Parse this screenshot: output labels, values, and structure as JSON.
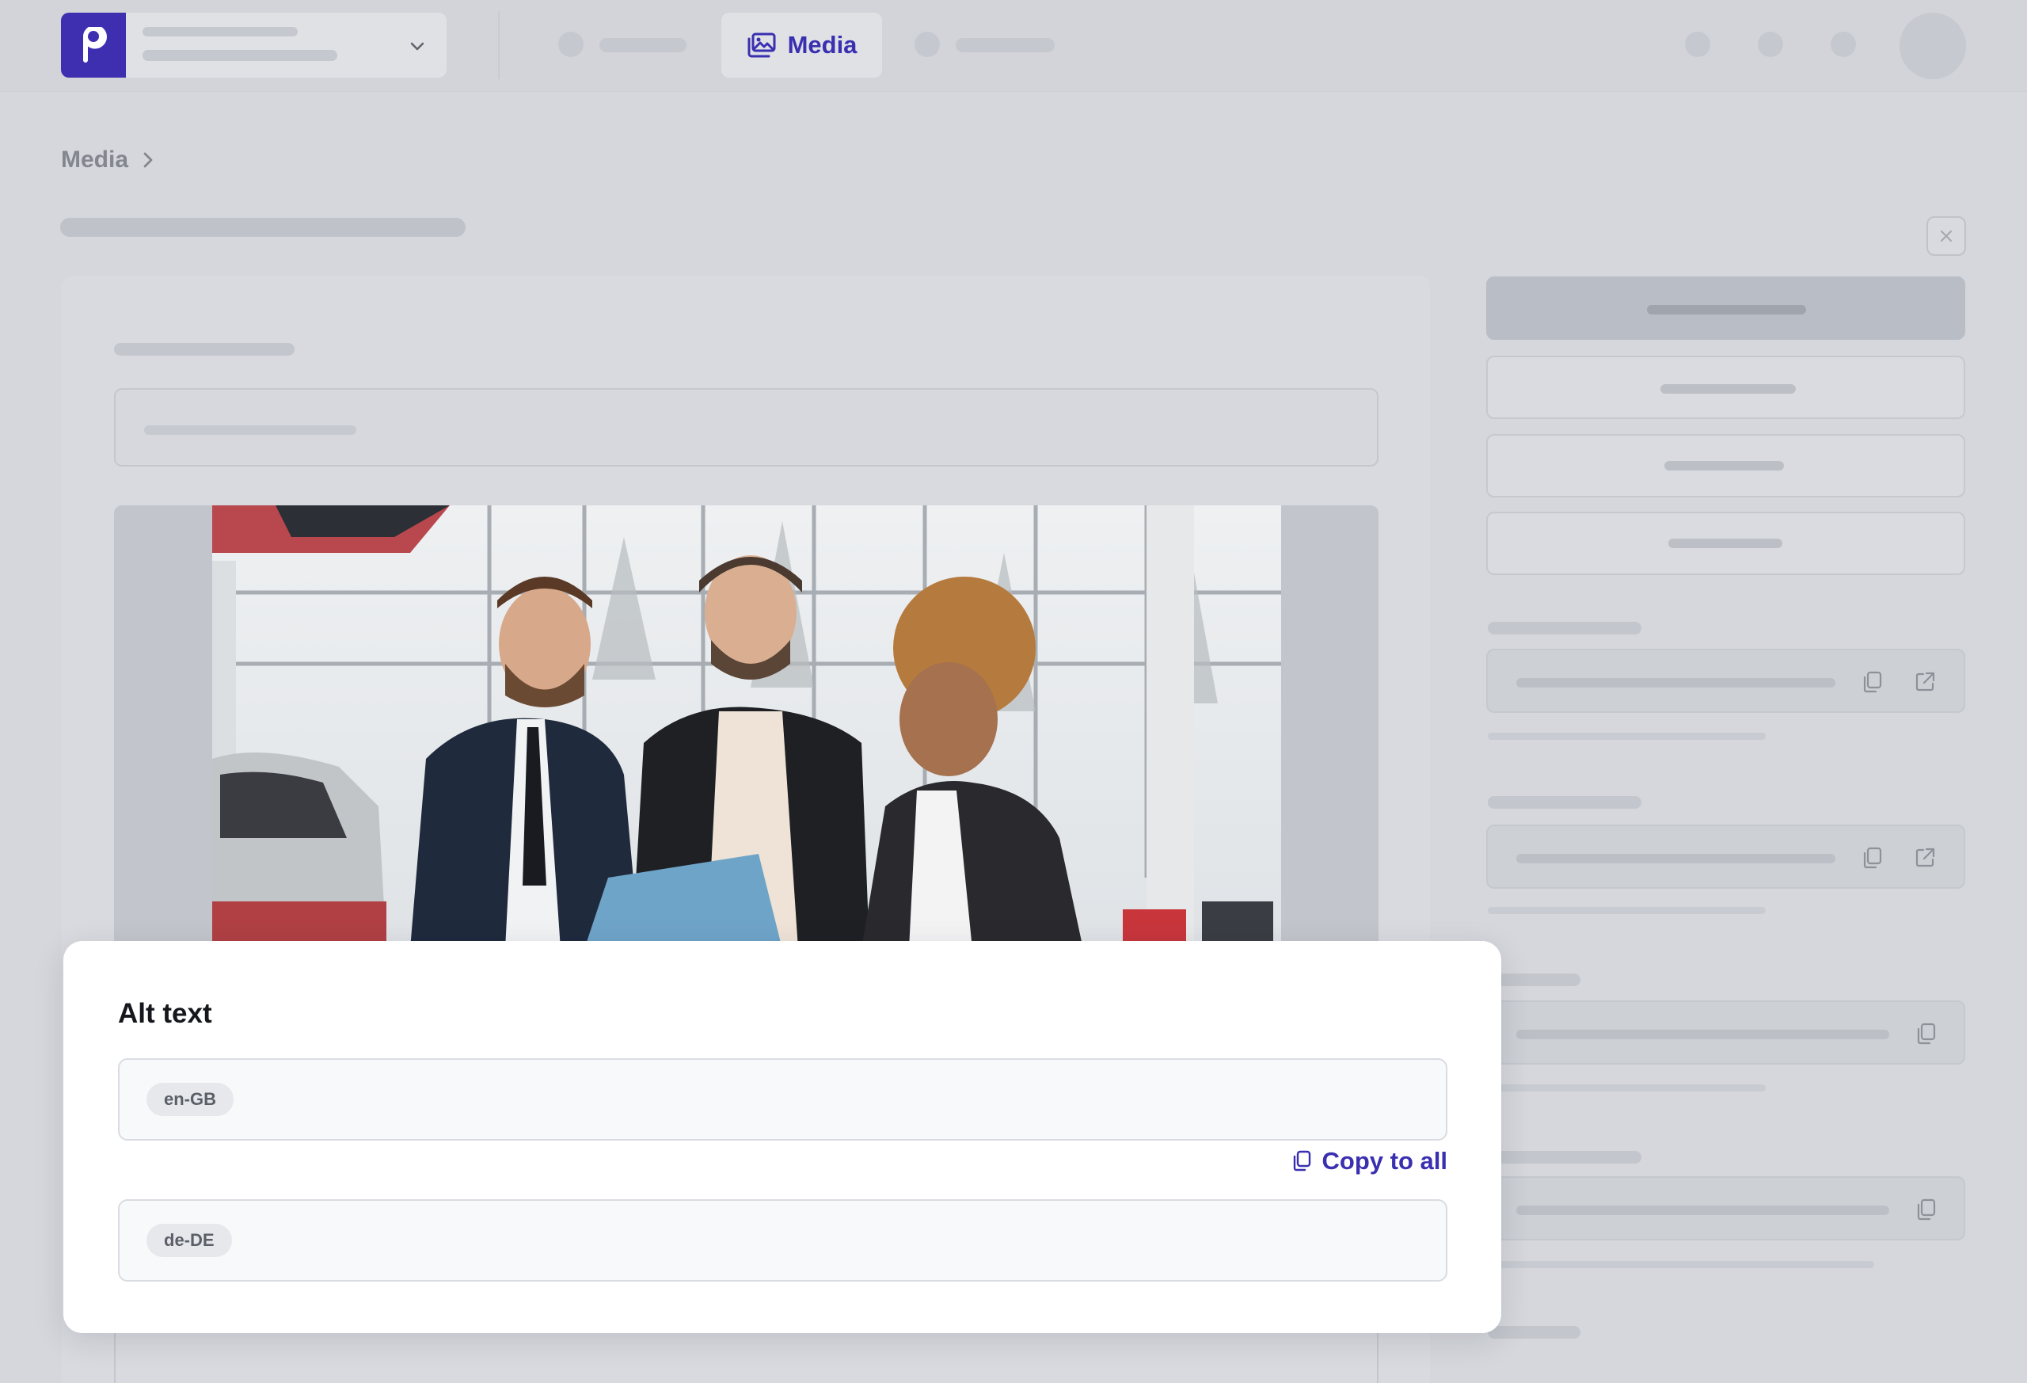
{
  "topnav": {
    "active_item": "Media",
    "icons": {
      "logo": "brand-logo-p",
      "media": "media-icon",
      "chevron": "chevron-down-icon"
    }
  },
  "breadcrumb": {
    "items": [
      "Media"
    ],
    "separator_icon": "chevron-right-icon"
  },
  "modal": {
    "title": "Alt text",
    "fields": [
      {
        "locale": "en-GB",
        "value": ""
      },
      {
        "locale": "de-DE",
        "value": ""
      }
    ],
    "copy_to_all_label": "Copy to all",
    "copy_icon": "copy-icon"
  },
  "colors": {
    "accent": "#3a2fb0",
    "overlay_background": "#d5d7dc",
    "modal_background": "#ffffff"
  }
}
